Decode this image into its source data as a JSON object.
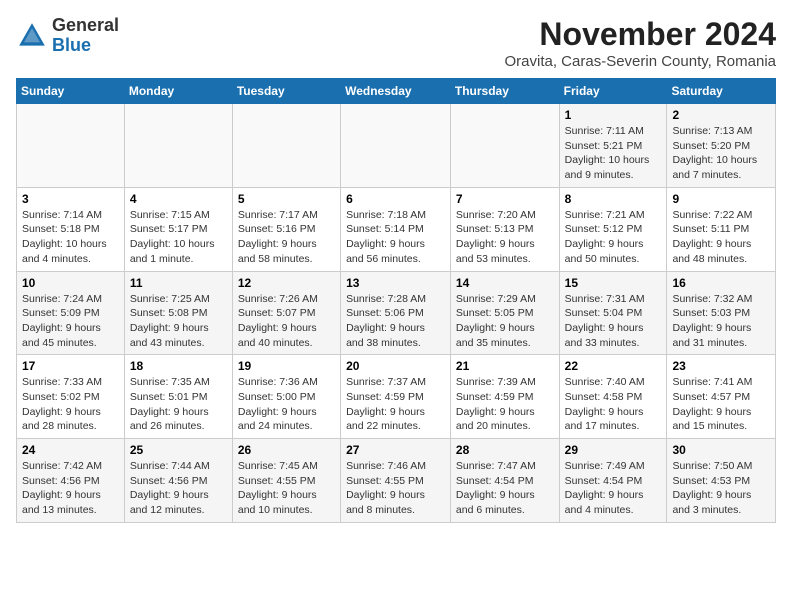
{
  "logo": {
    "general": "General",
    "blue": "Blue"
  },
  "title": "November 2024",
  "subtitle": "Oravita, Caras-Severin County, Romania",
  "headers": [
    "Sunday",
    "Monday",
    "Tuesday",
    "Wednesday",
    "Thursday",
    "Friday",
    "Saturday"
  ],
  "weeks": [
    [
      {
        "day": "",
        "info": ""
      },
      {
        "day": "",
        "info": ""
      },
      {
        "day": "",
        "info": ""
      },
      {
        "day": "",
        "info": ""
      },
      {
        "day": "",
        "info": ""
      },
      {
        "day": "1",
        "info": "Sunrise: 7:11 AM\nSunset: 5:21 PM\nDaylight: 10 hours and 9 minutes."
      },
      {
        "day": "2",
        "info": "Sunrise: 7:13 AM\nSunset: 5:20 PM\nDaylight: 10 hours and 7 minutes."
      }
    ],
    [
      {
        "day": "3",
        "info": "Sunrise: 7:14 AM\nSunset: 5:18 PM\nDaylight: 10 hours and 4 minutes."
      },
      {
        "day": "4",
        "info": "Sunrise: 7:15 AM\nSunset: 5:17 PM\nDaylight: 10 hours and 1 minute."
      },
      {
        "day": "5",
        "info": "Sunrise: 7:17 AM\nSunset: 5:16 PM\nDaylight: 9 hours and 58 minutes."
      },
      {
        "day": "6",
        "info": "Sunrise: 7:18 AM\nSunset: 5:14 PM\nDaylight: 9 hours and 56 minutes."
      },
      {
        "day": "7",
        "info": "Sunrise: 7:20 AM\nSunset: 5:13 PM\nDaylight: 9 hours and 53 minutes."
      },
      {
        "day": "8",
        "info": "Sunrise: 7:21 AM\nSunset: 5:12 PM\nDaylight: 9 hours and 50 minutes."
      },
      {
        "day": "9",
        "info": "Sunrise: 7:22 AM\nSunset: 5:11 PM\nDaylight: 9 hours and 48 minutes."
      }
    ],
    [
      {
        "day": "10",
        "info": "Sunrise: 7:24 AM\nSunset: 5:09 PM\nDaylight: 9 hours and 45 minutes."
      },
      {
        "day": "11",
        "info": "Sunrise: 7:25 AM\nSunset: 5:08 PM\nDaylight: 9 hours and 43 minutes."
      },
      {
        "day": "12",
        "info": "Sunrise: 7:26 AM\nSunset: 5:07 PM\nDaylight: 9 hours and 40 minutes."
      },
      {
        "day": "13",
        "info": "Sunrise: 7:28 AM\nSunset: 5:06 PM\nDaylight: 9 hours and 38 minutes."
      },
      {
        "day": "14",
        "info": "Sunrise: 7:29 AM\nSunset: 5:05 PM\nDaylight: 9 hours and 35 minutes."
      },
      {
        "day": "15",
        "info": "Sunrise: 7:31 AM\nSunset: 5:04 PM\nDaylight: 9 hours and 33 minutes."
      },
      {
        "day": "16",
        "info": "Sunrise: 7:32 AM\nSunset: 5:03 PM\nDaylight: 9 hours and 31 minutes."
      }
    ],
    [
      {
        "day": "17",
        "info": "Sunrise: 7:33 AM\nSunset: 5:02 PM\nDaylight: 9 hours and 28 minutes."
      },
      {
        "day": "18",
        "info": "Sunrise: 7:35 AM\nSunset: 5:01 PM\nDaylight: 9 hours and 26 minutes."
      },
      {
        "day": "19",
        "info": "Sunrise: 7:36 AM\nSunset: 5:00 PM\nDaylight: 9 hours and 24 minutes."
      },
      {
        "day": "20",
        "info": "Sunrise: 7:37 AM\nSunset: 4:59 PM\nDaylight: 9 hours and 22 minutes."
      },
      {
        "day": "21",
        "info": "Sunrise: 7:39 AM\nSunset: 4:59 PM\nDaylight: 9 hours and 20 minutes."
      },
      {
        "day": "22",
        "info": "Sunrise: 7:40 AM\nSunset: 4:58 PM\nDaylight: 9 hours and 17 minutes."
      },
      {
        "day": "23",
        "info": "Sunrise: 7:41 AM\nSunset: 4:57 PM\nDaylight: 9 hours and 15 minutes."
      }
    ],
    [
      {
        "day": "24",
        "info": "Sunrise: 7:42 AM\nSunset: 4:56 PM\nDaylight: 9 hours and 13 minutes."
      },
      {
        "day": "25",
        "info": "Sunrise: 7:44 AM\nSunset: 4:56 PM\nDaylight: 9 hours and 12 minutes."
      },
      {
        "day": "26",
        "info": "Sunrise: 7:45 AM\nSunset: 4:55 PM\nDaylight: 9 hours and 10 minutes."
      },
      {
        "day": "27",
        "info": "Sunrise: 7:46 AM\nSunset: 4:55 PM\nDaylight: 9 hours and 8 minutes."
      },
      {
        "day": "28",
        "info": "Sunrise: 7:47 AM\nSunset: 4:54 PM\nDaylight: 9 hours and 6 minutes."
      },
      {
        "day": "29",
        "info": "Sunrise: 7:49 AM\nSunset: 4:54 PM\nDaylight: 9 hours and 4 minutes."
      },
      {
        "day": "30",
        "info": "Sunrise: 7:50 AM\nSunset: 4:53 PM\nDaylight: 9 hours and 3 minutes."
      }
    ]
  ]
}
